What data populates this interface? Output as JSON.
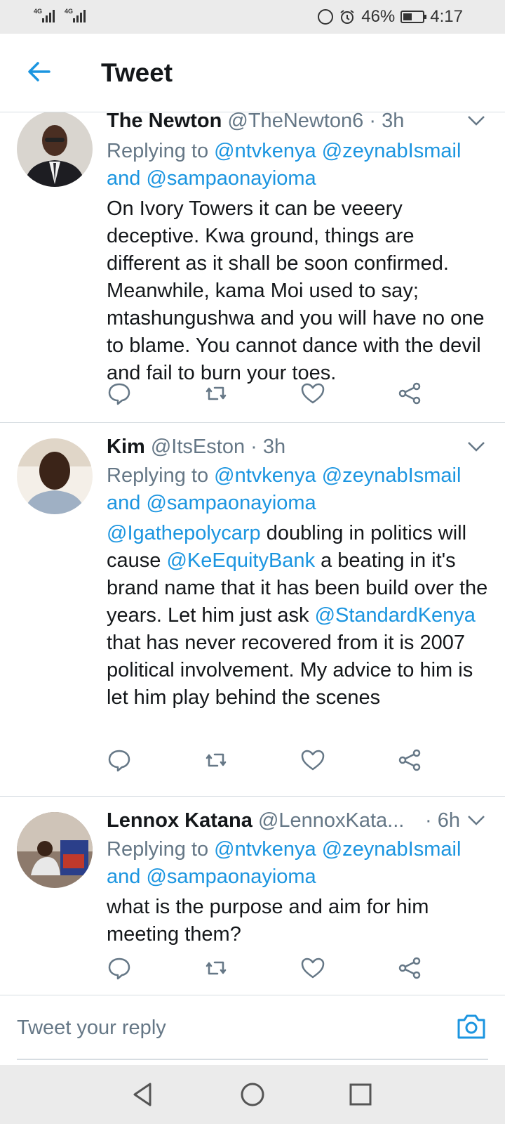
{
  "status_bar": {
    "signal_label": "4G",
    "battery": "46%",
    "battery_level": 0.46,
    "time": "4:17",
    "icons": [
      "signal-icon",
      "data-saver-icon",
      "alarm-icon",
      "battery-icon"
    ]
  },
  "header": {
    "title": "Tweet",
    "back_icon": "arrow-left-icon"
  },
  "tweets": [
    {
      "name": "The Newton",
      "handle": "@TheNewton6",
      "time": "3h",
      "reply_prefix": "Replying to",
      "mention_1": "@ntvkenya",
      "mention_2": "@zeynabIsmail",
      "reply_and": "and",
      "mention_3": "@sampaonayioma",
      "text": "On Ivory Towers it can be veeery deceptive. Kwa ground, things are different as it shall be soon confirmed. Meanwhile, kama Moi used to say; mtashungushwa and you will have no one to blame. You cannot dance with the devil and fail to burn your toes."
    },
    {
      "name": "Kim",
      "handle": "@ItsEston",
      "time": "3h",
      "reply_prefix": "Replying to",
      "mention_1": "@ntvkenya",
      "mention_2": "@zeynabIsmail",
      "reply_and": "and",
      "mention_3": "@sampaonayioma",
      "body_m1": "@Igathepolycarp",
      "body_t1": " doubling in politics will cause ",
      "body_m2": "@KeEquityBank",
      "body_t2": " a beating in it's brand name that it has been build over the years. Let him just ask ",
      "body_m3": "@StandardKenya",
      "body_t3": " that has never recovered from it is 2007 political involvement.  My advice to him is let him play behind the scenes"
    },
    {
      "name": "Lennox Katana",
      "handle": "@LennoxKata...",
      "time": "6h",
      "reply_prefix": "Replying to",
      "mention_1": "@ntvkenya",
      "mention_2": "@zeynabIsmail",
      "reply_and": "and",
      "mention_3": "@sampaonayioma",
      "text": "what is the purpose and aim for him meeting them?"
    }
  ],
  "reply_bar": {
    "placeholder": "Tweet your reply",
    "camera_icon": "camera-icon"
  },
  "nav": {
    "icons": [
      "back-triangle-icon",
      "home-circle-icon",
      "recents-square-icon"
    ]
  },
  "colors": {
    "accent": "#1b95e0",
    "secondary_text": "#657786",
    "divider": "#d7dde2",
    "system_bar": "#ebebeb"
  }
}
